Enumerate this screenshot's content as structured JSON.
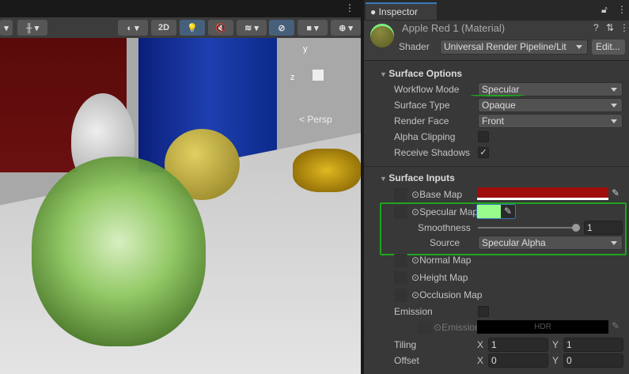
{
  "scene": {
    "toolbar": {
      "mode_2d": "2D",
      "persp_label": "< Persp",
      "gizmo_y": "y",
      "gizmo_z": "z"
    }
  },
  "inspector": {
    "tab_label": "Inspector",
    "material_name": "Apple Red 1 (Material)",
    "shader_label": "Shader",
    "shader_value": "Universal Render Pipeline/Lit",
    "edit_button": "Edit...",
    "surface_options": {
      "title": "Surface Options",
      "workflow_mode": {
        "label": "Workflow Mode",
        "value": "Specular"
      },
      "surface_type": {
        "label": "Surface Type",
        "value": "Opaque"
      },
      "render_face": {
        "label": "Render Face",
        "value": "Front"
      },
      "alpha_clipping": {
        "label": "Alpha Clipping",
        "checked": false
      },
      "receive_shadows": {
        "label": "Receive Shadows",
        "checked": true,
        "mark": "✓"
      }
    },
    "surface_inputs": {
      "title": "Surface Inputs",
      "base_map": {
        "label": "Base Map",
        "color": "#a00d0d"
      },
      "specular_map": {
        "label": "Specular Map",
        "color": "#98fc8c"
      },
      "smoothness": {
        "label": "Smoothness",
        "value": "1",
        "fraction": 1
      },
      "source": {
        "label": "Source",
        "value": "Specular Alpha"
      },
      "normal_map": {
        "label": "Normal Map"
      },
      "height_map": {
        "label": "Height Map"
      },
      "occlusion_map": {
        "label": "Occlusion Map"
      },
      "emission": {
        "label": "Emission",
        "map_label": "Emission Map",
        "hdr": "HDR"
      },
      "tiling": {
        "label": "Tiling",
        "x_label": "X",
        "x": "1",
        "y_label": "Y",
        "y": "1"
      },
      "offset": {
        "label": "Offset",
        "x_label": "X",
        "x": "0",
        "y_label": "Y",
        "y": "0"
      }
    }
  },
  "colors": {
    "highlight": "#1fa51f",
    "accent": "#46607c"
  }
}
